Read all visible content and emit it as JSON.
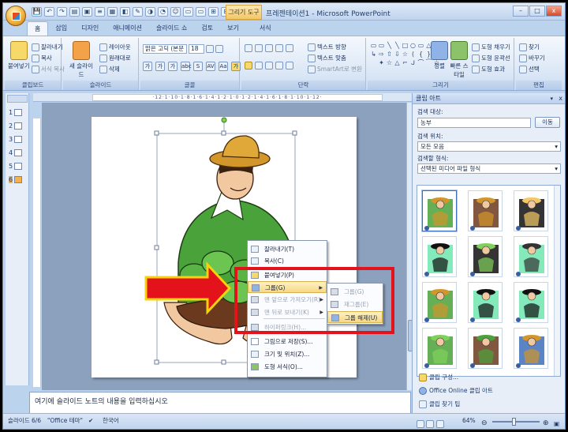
{
  "window": {
    "context_tab": "그리기 도구",
    "title": "프레젠테이션1 - Microsoft PowerPoint",
    "controls": [
      "–",
      "□",
      "x"
    ]
  },
  "qat": [
    "💾",
    "↶",
    "↷",
    "▤",
    "▣",
    "≡",
    "▦",
    "◧",
    "✎",
    "◑",
    "◔",
    "☺",
    "▭",
    "▭",
    "⊞",
    "⊟",
    "▾"
  ],
  "tabs": [
    "홈",
    "삽입",
    "디자인",
    "애니메이션",
    "슬라이드 쇼",
    "검토",
    "보기",
    "서식"
  ],
  "ribbon": {
    "clipboard": {
      "label": "클립보드",
      "paste": "붙여넣기",
      "cut": "잘라내기",
      "copy": "복사",
      "format_painter": "서식 복사"
    },
    "slides": {
      "label": "슬라이드",
      "new_slide": "새 슬라이드",
      "layout": "레이아웃",
      "reset": "원래대로",
      "delete": "삭제"
    },
    "font": {
      "label": "글꼴",
      "font_name": "맑은 고딕 (본문",
      "font_size": "18",
      "buttons": [
        "가",
        "가",
        "가",
        "abc",
        "S",
        "AV",
        "Aa",
        "가"
      ]
    },
    "paragraph": {
      "label": "단락",
      "text_direction": "텍스트 방향",
      "align_text": "텍스트 맞춤",
      "smartart": "SmartArt로 변환"
    },
    "drawing": {
      "label": "그리기",
      "arrange": "정렬",
      "quick_styles": "빠른 스타일",
      "fill": "도형 채우기",
      "outline": "도형 윤곽선",
      "effects": "도형 효과",
      "shapes": [
        "▭",
        "▭",
        "╲",
        "╲",
        "□",
        "○",
        "▭",
        "△",
        "⌐",
        "↳",
        "⇨",
        "⇧",
        "⇩",
        "☆",
        "(",
        "{",
        "}",
        "(",
        " ",
        "✦",
        "☆",
        "△",
        "⌐",
        "ᒍ",
        "⌒",
        "⁀",
        "☆"
      ]
    },
    "editing": {
      "label": "편집",
      "find": "찾기",
      "replace": "바꾸기",
      "select": "선택"
    }
  },
  "slides_pane": {
    "thumbnails": [
      "1",
      "2",
      "3",
      "4",
      "5",
      "6"
    ],
    "selected": "6"
  },
  "ruler_text": "·12·1·10·1·8·1·6·1·4·1·2·1·0·1·2·1·4·1·6·1·8·1·10·1·12·",
  "notes_placeholder": "여기에 슬라이드 노트의 내용을 입력하십시오",
  "status": {
    "slide": "슬라이드 6/6",
    "theme": "\"Office 테마\"",
    "language": "한국어",
    "zoom": "64%"
  },
  "clip_art": {
    "title": "클립 아트",
    "search_label": "검색 대상:",
    "search_value": "농부",
    "go_button": "이동",
    "location_label": "검색 위치:",
    "location_value": "모든 모음",
    "type_label": "검색할 형식:",
    "type_value": "선택된 미디어 파일 형식",
    "links": [
      "클립 구성...",
      "Office Online 클립 아트",
      "클립 찾기 팁"
    ]
  },
  "context_menu": {
    "items": [
      {
        "label": "잘라내기(T)",
        "enabled": true
      },
      {
        "label": "복사(C)",
        "enabled": true
      },
      {
        "label": "붙여넣기(P)",
        "enabled": true
      },
      {
        "label": "그룹(G)",
        "enabled": true,
        "highlighted": true,
        "submenu": true
      },
      {
        "label": "맨 앞으로 가져오기(R)",
        "enabled": false,
        "submenu": true
      },
      {
        "label": "맨 뒤로 보내기(K)",
        "enabled": false,
        "submenu": true
      },
      {
        "label": "하이퍼링크(H)...",
        "enabled": false
      },
      {
        "label": "그림으로 저장(S)...",
        "enabled": true
      },
      {
        "label": "크기 및 위치(Z)...",
        "enabled": true
      },
      {
        "label": "도형 서식(O)...",
        "enabled": true
      }
    ],
    "submenu_items": [
      {
        "label": "그룹(G)",
        "enabled": false
      },
      {
        "label": "재그룹(E)",
        "enabled": false
      },
      {
        "label": "그룹 해제(U)",
        "enabled": true,
        "highlighted": true
      }
    ]
  },
  "colors": {
    "annotation_red": "#e3121b",
    "ribbon_blue": "#bcd3ee",
    "highlight": "#f6d884"
  }
}
